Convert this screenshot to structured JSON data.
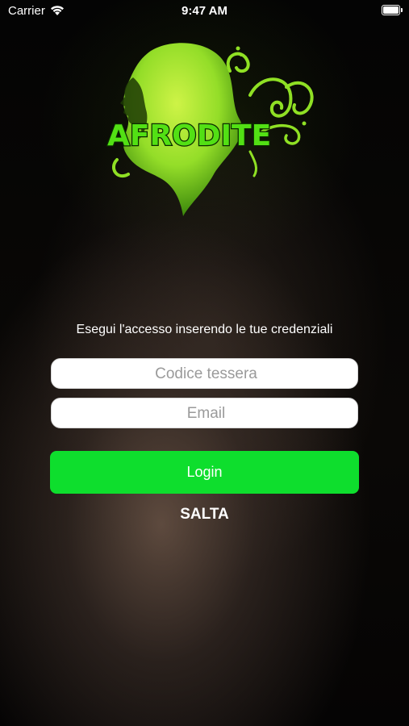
{
  "status_bar": {
    "carrier": "Carrier",
    "time": "9:47 AM",
    "icons": [
      "wifi-icon",
      "battery-icon"
    ]
  },
  "logo": {
    "text": "AFRODITE",
    "color": "#52e014"
  },
  "login": {
    "instructions": "Esegui l'accesso inserendo le tue credenziali",
    "card_placeholder": "Codice tessera",
    "card_value": "",
    "email_placeholder": "Email",
    "email_value": "",
    "login_label": "Login",
    "skip_label": "SALTA",
    "accent_color": "#0ede2d"
  }
}
